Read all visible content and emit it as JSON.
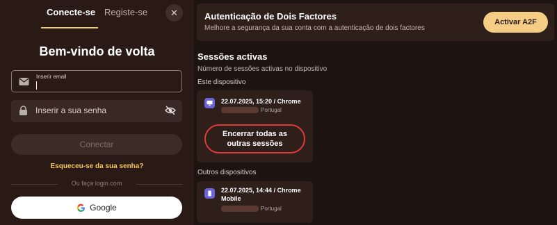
{
  "login": {
    "tab_login": "Conecte-se",
    "tab_register": "Registe-se",
    "close_icon": "close-icon",
    "welcome": "Bem-vindo de volta",
    "email_label": "Inserir email",
    "password_placeholder": "Inserir a sua senha",
    "connect_label": "Conectar",
    "forgot_label": "Esqueceu-se da sua senha?",
    "divider_text": "Ou faça login com",
    "google_label": "Google"
  },
  "a2f": {
    "title": "Autenticação de Dois Factores",
    "description": "Melhore a segurança da sua conta com a autenticação de dois factores",
    "button_label": "Activar A2F"
  },
  "sessions": {
    "title": "Sessões activas",
    "subtitle": "Número de sessões activas no dispositivo",
    "this_device_label": "Este dispositivo",
    "this_device": {
      "info": "22.07.2025, 15:20 / Chrome",
      "location": "Portugal",
      "icon": "monitor-icon"
    },
    "end_all_label": "Encerrar todas as outras sessões",
    "other_devices_label": "Outros dispositivos",
    "other_device": {
      "info": "22.07.2025, 14:44 / Chrome Mobile",
      "location": "Portugal",
      "icon": "phone-icon"
    }
  },
  "colors": {
    "background": "#1d1412",
    "panel": "#2a1a16",
    "card": "#2e1f1b",
    "accent_gold": "#f5cd84",
    "link_gold": "#f1c35c",
    "danger": "#e03a3a",
    "device_icon": "#6c63d8"
  }
}
